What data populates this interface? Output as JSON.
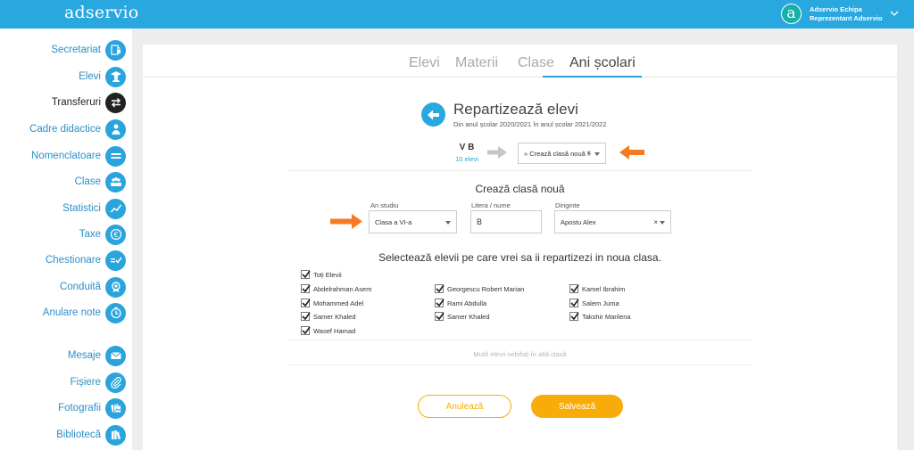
{
  "app": {
    "logo": "adservio"
  },
  "user": {
    "avatar_letter": "a",
    "name": "Adservio Echipa",
    "role": "Reprezentant Adservio"
  },
  "sidebar": {
    "items": [
      {
        "label": "Secretariat",
        "icon": "lock-document-icon"
      },
      {
        "label": "Elevi",
        "icon": "student-icon"
      },
      {
        "label": "Transferuri",
        "icon": "transfer-arrows-icon",
        "active": true
      },
      {
        "label": "Cadre didactice",
        "icon": "teacher-icon"
      },
      {
        "label": "Nomenclatoare",
        "icon": "list-bars-icon"
      },
      {
        "label": "Clase",
        "icon": "class-group-icon"
      },
      {
        "label": "Statistici",
        "icon": "statistics-chart-icon"
      },
      {
        "label": "Taxe",
        "icon": "euro-icon"
      },
      {
        "label": "Chestionare",
        "icon": "survey-check-icon"
      },
      {
        "label": "Conduită",
        "icon": "conduct-medal-icon"
      },
      {
        "label": "Anulare note",
        "icon": "cancel-grade-icon"
      },
      {
        "label": "Mesaje",
        "icon": "mail-icon"
      },
      {
        "label": "Fișiere",
        "icon": "paperclip-icon"
      },
      {
        "label": "Fotografii",
        "icon": "photos-icon"
      },
      {
        "label": "Bibliotecă",
        "icon": "library-books-icon"
      }
    ]
  },
  "tabs": [
    {
      "label": "Elevi"
    },
    {
      "label": "Materii"
    },
    {
      "label": "Clase"
    },
    {
      "label": "Ani școlari",
      "active": true
    }
  ],
  "header": {
    "title": "Repartizează elevi",
    "subtitle": "Din anul școlar 2020/2021 în anul școlar 2021/2022"
  },
  "source_class": {
    "name": "V B",
    "count": "10 elevi"
  },
  "target_select": {
    "value": "» Crează clasă nouă »",
    "clear": "×"
  },
  "new_class": {
    "title": "Crează clasă nouă",
    "an_studiu": {
      "label": "An studiu",
      "value": "Clasa a VI-a"
    },
    "litera": {
      "label": "Litera / nume",
      "value": "B"
    },
    "diriginte": {
      "label": "Diriginte",
      "value": "Apostu Alex",
      "clear": "×"
    }
  },
  "students_section": {
    "title": "Selectează elevii pe care vrei sa ii repartizezi in noua clasa.",
    "select_all": "Toți Elevii",
    "students": [
      "Abdelrahman Asem",
      "Georgescu Robert Marian",
      "Kamel Ibrahim",
      "Mohammed Adel",
      "Rami Abdulla",
      "Salem Juma",
      "Samer Khaled",
      "Samer Khaled",
      "Takshir Marilena",
      "Wasef Hamad"
    ]
  },
  "move_unchecked": "Mută elevii nebifați în altă clasă",
  "actions": {
    "cancel": "Anulează",
    "save": "Salvează"
  },
  "colors": {
    "primary": "#29a7df",
    "accent": "#f7ac0a",
    "arrow": "#f47b20"
  }
}
